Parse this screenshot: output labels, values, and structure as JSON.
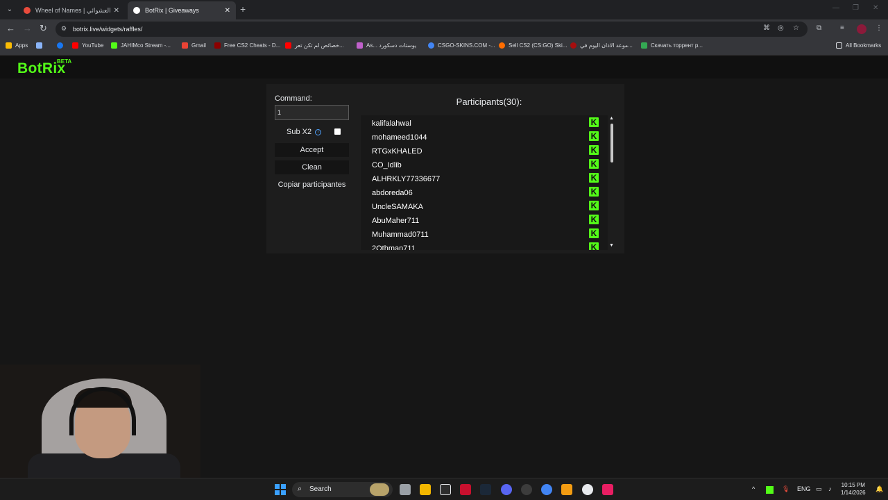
{
  "browser": {
    "tabs": [
      {
        "title": "Wheel of Names | اسم العشوائي",
        "favicon_color": "#e94b3c"
      },
      {
        "title": "BotRix | Giveaways",
        "favicon_color": "#ffffff"
      }
    ],
    "url": "botrix.live/widgets/raffles/",
    "bookmarks": [
      {
        "label": "Apps",
        "color": "#fbbc04"
      },
      {
        "label": "",
        "color": "#8ab4f8"
      },
      {
        "label": "",
        "color": "#1877f2"
      },
      {
        "label": "YouTube",
        "color": "#ff0000"
      },
      {
        "label": "JAHIMco Stream -...",
        "color": "#53fc18"
      },
      {
        "label": "Gmail",
        "color": "#ea4335"
      },
      {
        "label": "Free CS2 Cheats - D...",
        "color": "#8b0000"
      },
      {
        "label": "خصائص لم تكن تعر...",
        "color": "#ff0000"
      },
      {
        "label": "As... يوستات دسكورد",
        "color": "#c061cb"
      },
      {
        "label": "CSGO-SKINS.COM -...",
        "color": "#4285f4"
      },
      {
        "label": "Sell CS2 (CS:GO) Ski...",
        "color": "#ff6d00"
      },
      {
        "label": "موعد الاذان اليوم في...",
        "color": "#a50e0e"
      },
      {
        "label": "Скачать торрент р...",
        "color": "#34a853"
      }
    ],
    "all_bookmarks": "All Bookmarks"
  },
  "site": {
    "logo": "BotRix",
    "beta": "BETA"
  },
  "raffle": {
    "command_label": "Command:",
    "command_value": "1",
    "sub_label": "Sub X2",
    "accept_label": "Accept",
    "clean_label": "Clean",
    "copy_label": "Copiar participantes",
    "participants_title": "Participants(30):",
    "participants": [
      "kalifalahwal",
      "mohameed1044",
      "RTGxKHALED",
      "CO_Idlib",
      "ALHRKLY77336677",
      "abdoreda06",
      "UncleSAMAKA",
      "AbuMaher711",
      "Muhammad0711",
      "2Othman711"
    ],
    "platform_icon": "K"
  },
  "taskbar": {
    "search_label": "Search",
    "language": "ENG",
    "time": "10:15 PM",
    "date": "1/14/2026"
  }
}
